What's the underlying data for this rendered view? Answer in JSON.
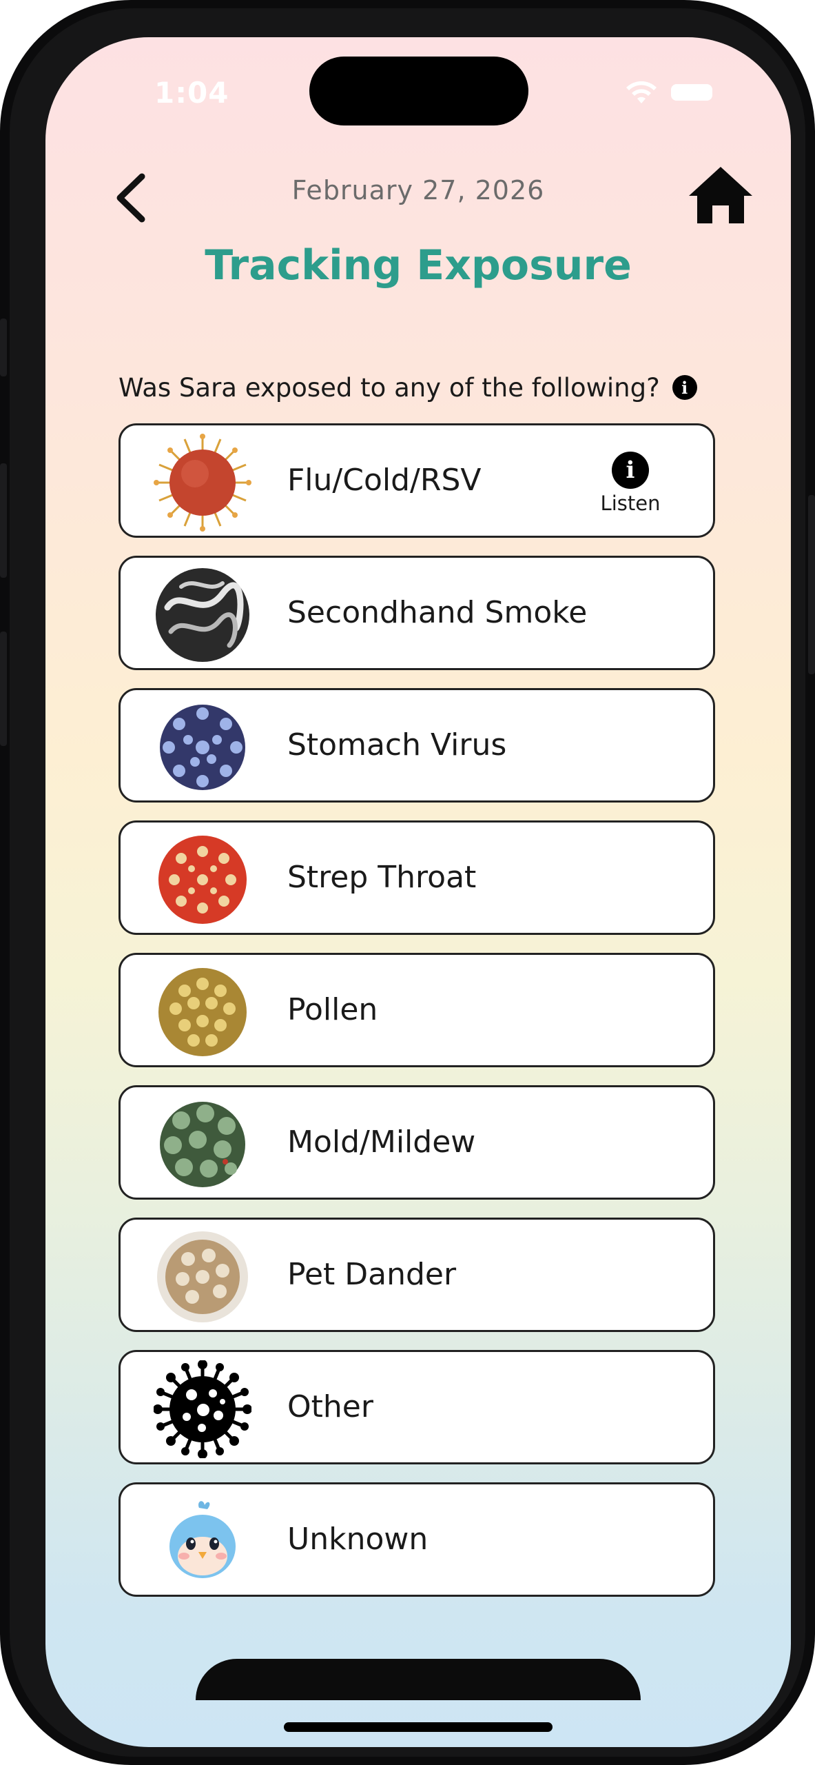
{
  "status_bar": {
    "time": "1:04"
  },
  "header": {
    "date": "February 27, 2026",
    "title": "Tracking Exposure"
  },
  "question": {
    "text": "Was Sara exposed to any of the following?"
  },
  "listen_label": "Listen",
  "options": [
    {
      "label": "Flu/Cold/RSV",
      "icon": "flu-virus-icon"
    },
    {
      "label": "Secondhand Smoke",
      "icon": "smoke-sphere-icon"
    },
    {
      "label": "Stomach Virus",
      "icon": "stomach-virus-icon"
    },
    {
      "label": "Strep Throat",
      "icon": "strep-bacteria-icon"
    },
    {
      "label": "Pollen",
      "icon": "pollen-icon"
    },
    {
      "label": "Mold/Mildew",
      "icon": "mold-icon"
    },
    {
      "label": "Pet Dander",
      "icon": "pet-dander-icon"
    },
    {
      "label": "Other",
      "icon": "generic-virus-icon"
    },
    {
      "label": "Unknown",
      "icon": "bird-mascot-icon"
    }
  ],
  "colors": {
    "title": "#2d9d8c",
    "card_border": "#222222",
    "background_top": "#fde1e3",
    "background_bottom": "#cde5f4"
  }
}
